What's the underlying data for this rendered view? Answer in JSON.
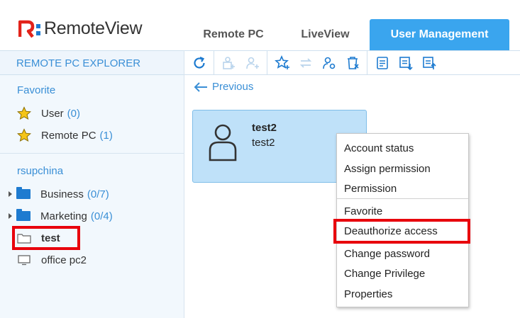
{
  "app": {
    "name": "RemoteView"
  },
  "tabs": [
    {
      "label": "Remote PC"
    },
    {
      "label": "LiveView"
    },
    {
      "label": "User Management",
      "active": true
    }
  ],
  "explorer": {
    "header": "REMOTE PC EXPLORER",
    "favorite": {
      "title": "Favorite",
      "items": [
        {
          "label": "User",
          "count": "(0)",
          "icon": "star-icon"
        },
        {
          "label": "Remote PC",
          "count": "(1)",
          "icon": "star-icon"
        }
      ]
    },
    "group": {
      "title": "rsupchina",
      "items": [
        {
          "label": "Business",
          "count": "(0/7)",
          "icon": "folder-icon"
        },
        {
          "label": "Marketing",
          "count": "(0/4)",
          "icon": "folder-icon"
        },
        {
          "label": "test",
          "count": "",
          "icon": "folder-outline-icon",
          "highlighted": true
        },
        {
          "label": "office pc2",
          "count": "",
          "icon": "monitor-icon"
        }
      ]
    }
  },
  "toolbar": {
    "icons": [
      "refresh-icon",
      "add-user-group-icon",
      "add-user-icon",
      "add-favorite-icon",
      "move-icon",
      "user-permission-icon",
      "delete-icon",
      "notes-icon",
      "export-icon",
      "import-icon"
    ]
  },
  "main": {
    "previous_label": "Previous",
    "card": {
      "title": "test2",
      "subtitle": "test2"
    }
  },
  "context_menu": {
    "items": [
      "Account status",
      "Assign permission",
      "Permission",
      "Favorite",
      "Deauthorize access",
      "Change password",
      "Change Privilege",
      "Properties"
    ],
    "highlighted": "Deauthorize access"
  },
  "colors": {
    "accent": "#3aa5ee",
    "link": "#3a8fd6",
    "highlight": "#e8000c",
    "logo_red": "#e2231a",
    "logo_blue": "#1e7bd0"
  }
}
